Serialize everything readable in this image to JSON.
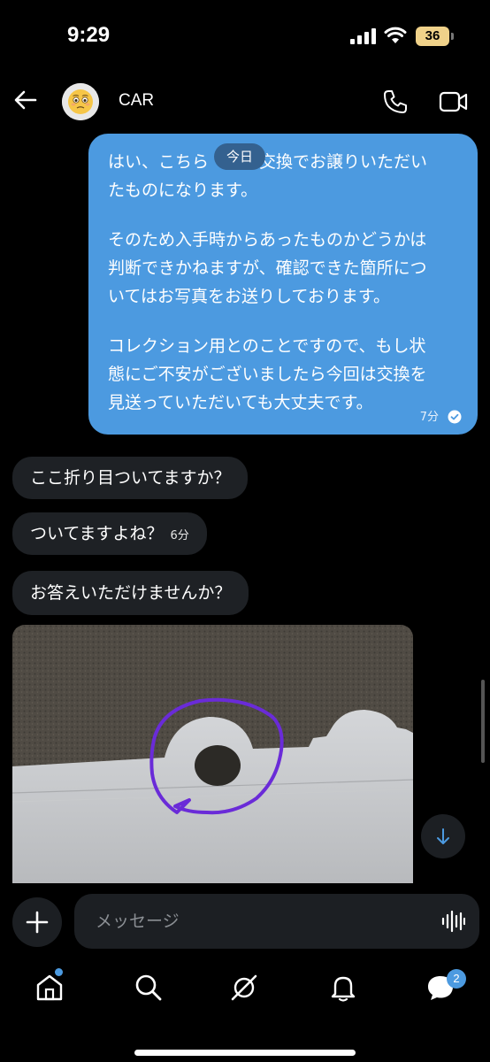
{
  "status_bar": {
    "time": "9:29",
    "battery": "36"
  },
  "header": {
    "contact_name": "CAR"
  },
  "date_divider": "今日",
  "messages": [
    {
      "direction": "outgoing",
      "lines": [
        "はい、こちら　　　交換でお譲りいただい",
        "たものになります。",
        "",
        "そのため入手時からあったものかどうかは",
        "判断できかねますが、確認できた箇所につ",
        "いてはお写真をお送りしております。",
        "",
        "コレクション用とのことですので、もし状",
        "態にご不安がございましたら今回は交換を",
        "見送っていただいても大丈夫です。"
      ],
      "time": "7分",
      "status": "read"
    },
    {
      "direction": "incoming",
      "text": "ここ折り目ついてますか？"
    },
    {
      "direction": "incoming",
      "text": "ついてますよね？",
      "time": "6分"
    },
    {
      "direction": "incoming",
      "text": "お答えいただけませんか？"
    },
    {
      "direction": "incoming",
      "type": "photo"
    }
  ],
  "composer": {
    "placeholder": "メッセージ"
  },
  "nav": {
    "items": [
      "home-icon",
      "search-icon",
      "grok-icon",
      "notifications-icon",
      "messages-icon"
    ],
    "messages_badge": "2"
  },
  "colors": {
    "accent": "#4c9ae0",
    "bubble_in": "#1e2125",
    "background": "#000000",
    "annotation": "#6a2bd8"
  }
}
